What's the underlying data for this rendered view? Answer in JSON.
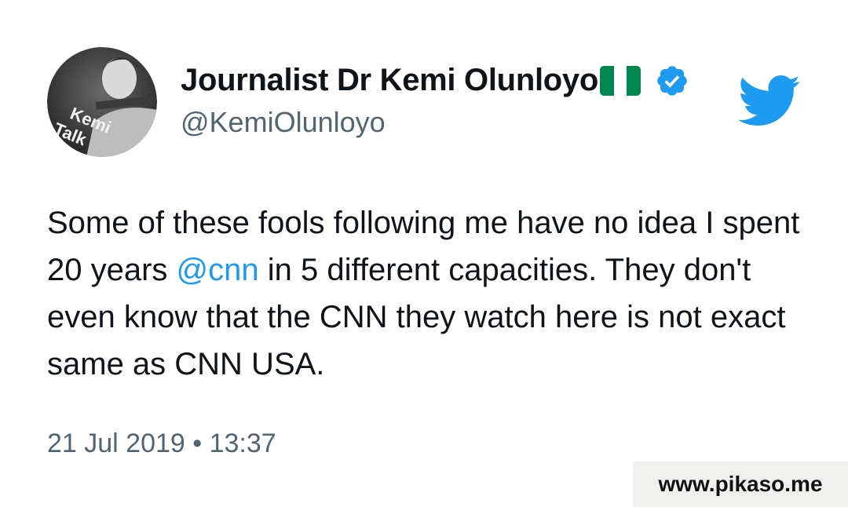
{
  "author": {
    "display_name": "Journalist Dr Kemi Olunloyo",
    "handle": "@KemiOlunloyo",
    "flag_icon": "nigeria-flag-icon",
    "verified_icon": "verified-badge-icon",
    "avatar_text_main": "Kemi",
    "avatar_text_sub": "Talk"
  },
  "tweet": {
    "text_part1": "Some of these fools following  me have no idea I spent 20 years ",
    "mention": "@cnn",
    "text_part2": " in 5 different capacities. They don't even know that the CNN they watch here is not exact same as CNN USA."
  },
  "meta": {
    "timestamp": "21 Jul 2019 • 13:37"
  },
  "brand": {
    "logo_icon": "twitter-bird-icon",
    "watermark": "www.pikaso.me"
  },
  "colors": {
    "accent": "#1d9bf0",
    "text": "#0f1419",
    "secondary_text": "#536471",
    "nigeria_green": "#008751"
  }
}
